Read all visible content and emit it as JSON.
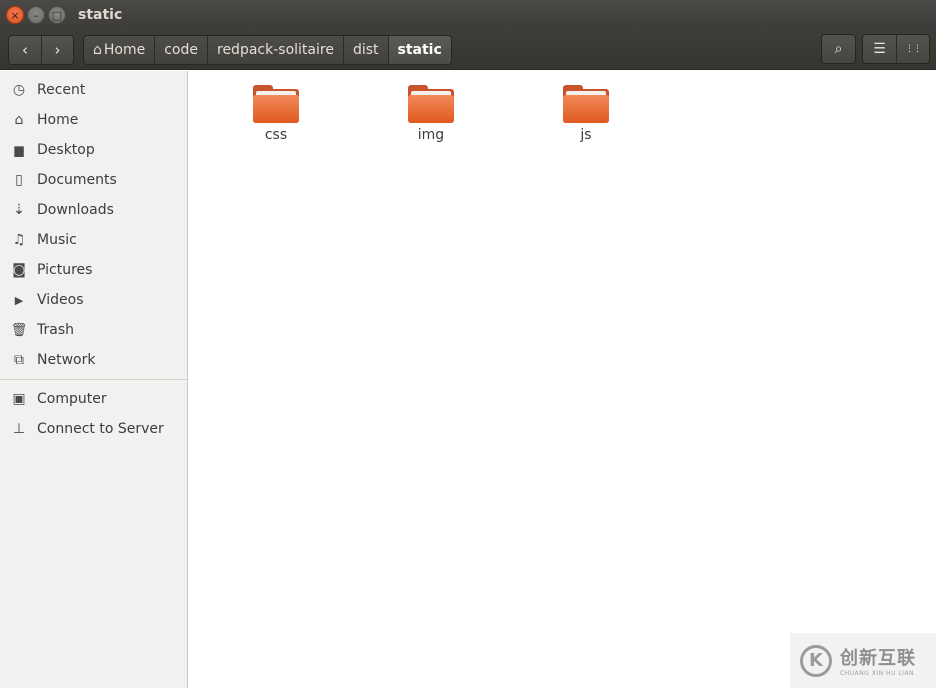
{
  "window": {
    "title": "static",
    "controls": {
      "close": "×",
      "minimize": "–",
      "maximize": "□"
    }
  },
  "toolbar": {
    "back_glyph": "‹",
    "forward_glyph": "›",
    "breadcrumbs": [
      {
        "label": "Home",
        "icon": "home-icon"
      },
      {
        "label": "code"
      },
      {
        "label": "redpack-solitaire"
      },
      {
        "label": "dist"
      },
      {
        "label": "static",
        "active": true
      }
    ],
    "search_glyph": "⌕",
    "list_view_glyph": "☰",
    "grid_view_glyph": "⋮⋮"
  },
  "sidebar": {
    "places": [
      {
        "label": "Recent",
        "icon": "clock-icon",
        "glyph": "◷"
      },
      {
        "label": "Home",
        "icon": "home-icon",
        "glyph": "⌂"
      },
      {
        "label": "Desktop",
        "icon": "folder-icon",
        "glyph": "▆"
      },
      {
        "label": "Documents",
        "icon": "document-icon",
        "glyph": "▯"
      },
      {
        "label": "Downloads",
        "icon": "download-icon",
        "glyph": "⇣"
      },
      {
        "label": "Music",
        "icon": "music-icon",
        "glyph": "♫"
      },
      {
        "label": "Pictures",
        "icon": "camera-icon",
        "glyph": "◙"
      },
      {
        "label": "Videos",
        "icon": "video-icon",
        "glyph": "▶"
      },
      {
        "label": "Trash",
        "icon": "trash-icon",
        "glyph": "🗑"
      },
      {
        "label": "Network",
        "icon": "network-icon",
        "glyph": "⧉"
      }
    ],
    "devices": [
      {
        "label": "Computer",
        "icon": "computer-icon",
        "glyph": "▣"
      },
      {
        "label": "Connect to Server",
        "icon": "server-icon",
        "glyph": "⊥"
      }
    ]
  },
  "files": [
    {
      "name": "css",
      "type": "folder"
    },
    {
      "name": "img",
      "type": "folder"
    },
    {
      "name": "js",
      "type": "folder"
    }
  ],
  "watermark": {
    "logo_glyph": "K",
    "text": "创新互联",
    "subtext": "CHUANG XIN HU LIAN"
  },
  "colors": {
    "accent": "#e0591f",
    "titlebar": "#3d3c39",
    "sidebar": "#f2f1f0"
  }
}
